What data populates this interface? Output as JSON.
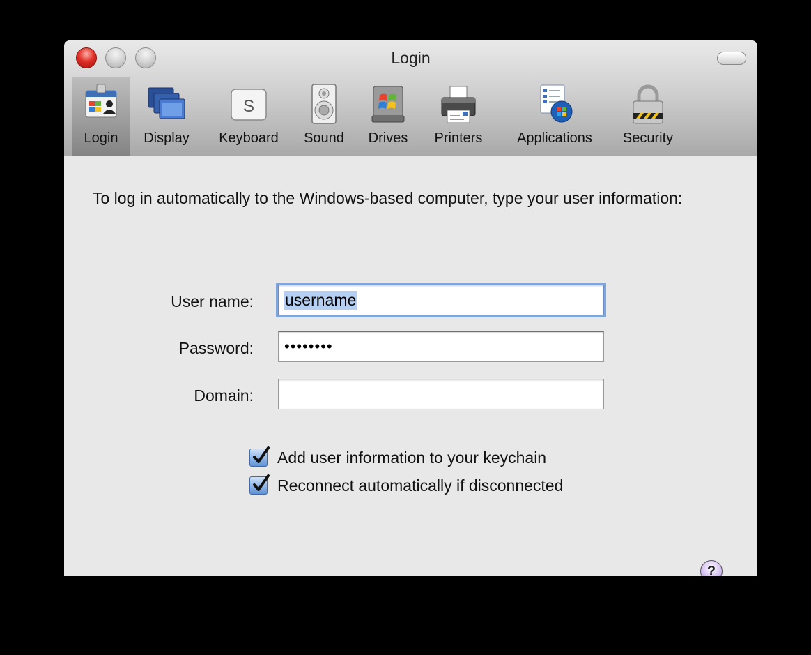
{
  "window": {
    "title": "Login"
  },
  "toolbar": {
    "items": [
      {
        "label": "Login",
        "icon": "login-icon",
        "selected": true
      },
      {
        "label": "Display",
        "icon": "display-icon"
      },
      {
        "label": "Keyboard",
        "icon": "keyboard-icon",
        "key_glyph": "S"
      },
      {
        "label": "Sound",
        "icon": "sound-icon"
      },
      {
        "label": "Drives",
        "icon": "drives-icon"
      },
      {
        "label": "Printers",
        "icon": "printers-icon"
      },
      {
        "label": "Applications",
        "icon": "applications-icon"
      },
      {
        "label": "Security",
        "icon": "security-icon"
      }
    ]
  },
  "content": {
    "intro": "To log in automatically to the Windows-based computer, type your user information:",
    "fields": {
      "username": {
        "label": "User name:",
        "value": "username"
      },
      "password": {
        "label": "Password:",
        "value": "••••••••"
      },
      "domain": {
        "label": "Domain:",
        "value": ""
      }
    },
    "checkboxes": [
      {
        "label": "Add user information to your keychain",
        "checked": true
      },
      {
        "label": "Reconnect automatically if disconnected",
        "checked": true
      }
    ],
    "help_glyph": "?"
  }
}
